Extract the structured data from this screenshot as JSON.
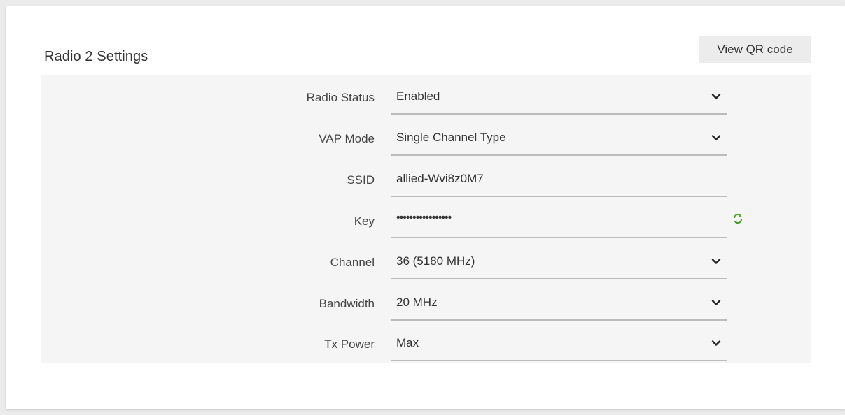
{
  "card": {
    "title": "Radio 2 Settings",
    "qr_button_label": "View QR code"
  },
  "form": {
    "radio_status": {
      "label": "Radio Status",
      "value": "Enabled",
      "type": "select"
    },
    "vap_mode": {
      "label": "VAP Mode",
      "value": "Single Channel Type",
      "type": "select"
    },
    "ssid": {
      "label": "SSID",
      "value": "allied-Wvi8z0M7",
      "type": "text"
    },
    "key": {
      "label": "Key",
      "value": "•••••••••••••••••",
      "type": "password",
      "regenerate_icon": "refresh-icon"
    },
    "channel": {
      "label": "Channel",
      "value": "36 (5180 MHz)",
      "type": "select"
    },
    "bandwidth": {
      "label": "Bandwidth",
      "value": "20 MHz",
      "type": "select"
    },
    "tx_power": {
      "label": "Tx Power",
      "value": "Max",
      "type": "select"
    }
  },
  "colors": {
    "page_bg": "#ebebeb",
    "card_bg": "#ffffff",
    "panel_bg": "#f5f5f5",
    "button_bg": "#ececec",
    "underline": "#bcbcbc",
    "refresh_icon": "#5aa832"
  }
}
